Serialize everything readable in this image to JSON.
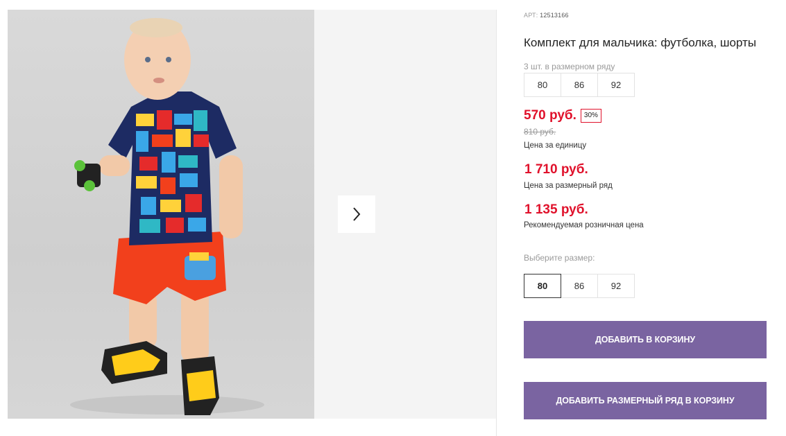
{
  "product": {
    "art_label": "АРТ:",
    "art_number": "12513166",
    "title": "Комплект для мальчика: футболка, шорты",
    "pack_label": "3 шт. в размерном ряду",
    "pack_sizes": [
      "80",
      "86",
      "92"
    ],
    "price": "570 руб.",
    "discount": "30%",
    "old_price": "810 руб.",
    "unit_price_label": "Цена за единицу",
    "pack_price": "1 710 руб.",
    "pack_price_label": "Цена за размерный ряд",
    "retail_price": "1 135 руб.",
    "retail_price_label": "Рекомендуемая розничная цена",
    "choose_size_label": "Выберите размер:",
    "sizes": [
      "80",
      "86",
      "92"
    ],
    "selected_size": "80"
  },
  "buttons": {
    "add_to_cart": "ДОБАВИТЬ В КОРЗИНУ",
    "add_pack_to_cart": "ДОБАВИТЬ РАЗМЕРНЫЙ РЯД В КОРЗИНУ"
  },
  "gallery": {
    "arrow_icon": "chevron-right-icon"
  },
  "colors": {
    "price_red": "#e0112b",
    "button_purple": "#7a64a1"
  }
}
